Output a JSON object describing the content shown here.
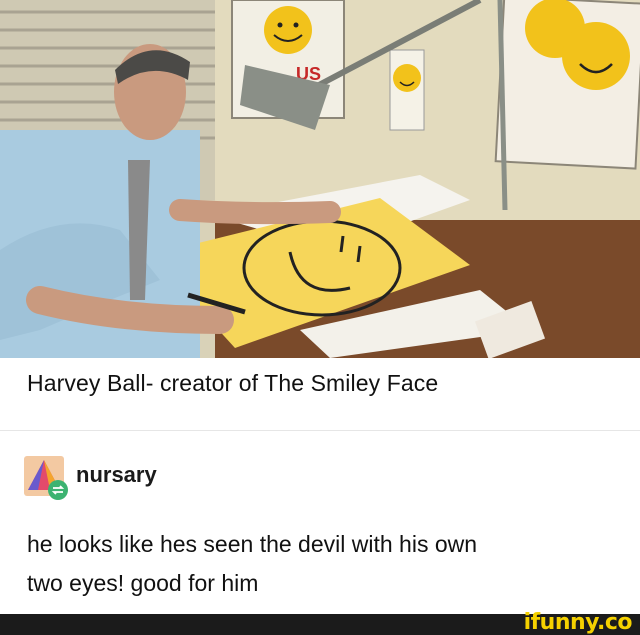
{
  "post": {
    "image_caption": "Harvey Ball- creator of The Smiley Face",
    "photo_label": "US"
  },
  "reblog": {
    "username": "nursary",
    "avatar_icon": "pyramid-avatar-icon",
    "reblog_badge_icon": "reblog-icon",
    "comment_line1": "he looks like hes seen the devil with his own",
    "comment_line2": "two eyes! good for him"
  },
  "footer": {
    "brand": "ifunny.co",
    "brand_color": "#f5d100"
  }
}
